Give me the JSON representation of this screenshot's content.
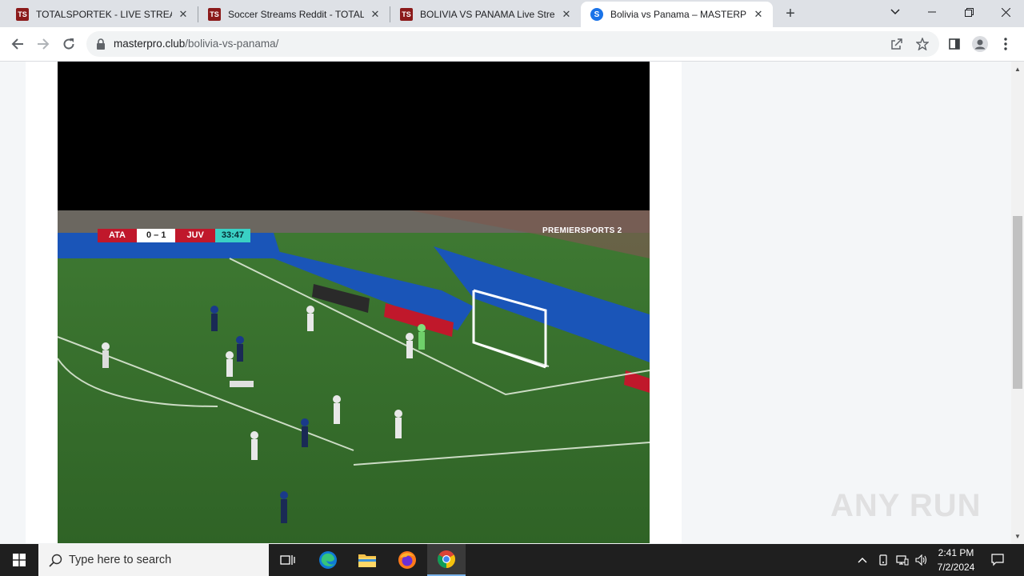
{
  "browser": {
    "tabs": [
      {
        "title": "TOTALSPORTEK - LIVE STREAMS",
        "favicon": "TS",
        "active": false
      },
      {
        "title": "Soccer Streams Reddit - TOTALSP",
        "favicon": "TS",
        "active": false
      },
      {
        "title": "BOLIVIA VS PANAMA Live Stream",
        "favicon": "TS",
        "active": false
      },
      {
        "title": "Bolivia vs Panama – MASTERPRO",
        "favicon": "S",
        "active": true
      }
    ],
    "url_host": "masterpro.club",
    "url_path": "/bolivia-vs-panama/"
  },
  "video": {
    "scoreboard": {
      "home": "ATA",
      "score": "0 – 1",
      "away": "JUV",
      "clock": "33:47"
    },
    "broadcaster": "PREMIERSPORTS 2"
  },
  "watermark": "ANY RUN",
  "taskbar": {
    "search_placeholder": "Type here to search",
    "time": "2:41 PM",
    "date": "7/2/2024"
  }
}
